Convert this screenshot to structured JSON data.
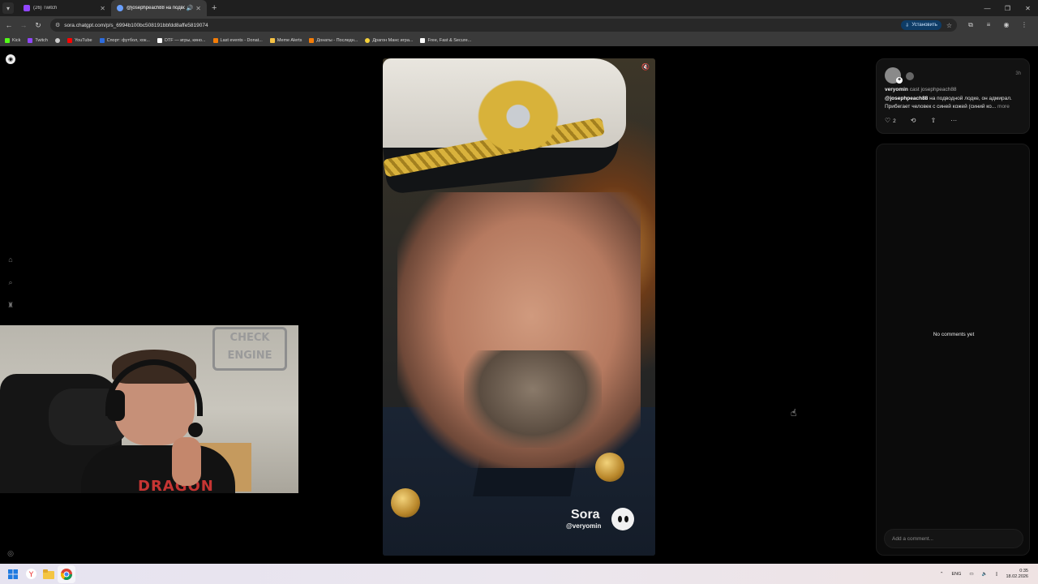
{
  "browser": {
    "tabs": [
      {
        "title": "(26) Twitch",
        "active": false,
        "favicon_color": "#9146ff"
      },
      {
        "title": "@josephpeach88 на подвод",
        "active": true,
        "favicon_color": "#6aa0ff"
      }
    ],
    "url": "sora.chatgpt.com/p/s_6994b100bc508191bbfdd8affe5819074",
    "install_label": "Установить",
    "bookmarks": [
      {
        "label": "Kick",
        "color": "#53fc18"
      },
      {
        "label": "Twitch",
        "color": "#9146ff"
      },
      {
        "label": "",
        "color": "#cccccc"
      },
      {
        "label": "YouTube",
        "color": "#ff0000"
      },
      {
        "label": "Спорт: футбол, хок...",
        "color": "#2d6cdf"
      },
      {
        "label": "DTF — игры, кино...",
        "color": "#ffffff"
      },
      {
        "label": "Last events - Donat...",
        "color": "#f57d07"
      },
      {
        "label": "Meme Alerts",
        "color": "#f6c244"
      },
      {
        "label": "Донаты - Последн...",
        "color": "#f57d07"
      },
      {
        "label": "Драгон Манс игра...",
        "color": "#f6d23b"
      },
      {
        "label": "Free, Fast & Secure...",
        "color": "#ffffff"
      }
    ]
  },
  "post": {
    "author": "veryomin",
    "cast_label": "cast",
    "cast_user": "josephpeach88",
    "time": "3h",
    "mention": "@josephpeach88",
    "text": " на подводной лодке, он адмирал. Прибегает человек с синей кожей (синий ко...",
    "more_label": "more",
    "likes": "2"
  },
  "comments": {
    "empty_label": "No comments yet",
    "input_placeholder": "Add a comment..."
  },
  "video": {
    "watermark_name": "Sora",
    "watermark_handle": "@veryomin"
  },
  "webcam": {
    "sign_text": "CHECK ENGINE",
    "shirt_text": "DRAGON"
  },
  "taskbar": {
    "language": "ENG",
    "time": "0:35",
    "date": "18.02.2026"
  }
}
